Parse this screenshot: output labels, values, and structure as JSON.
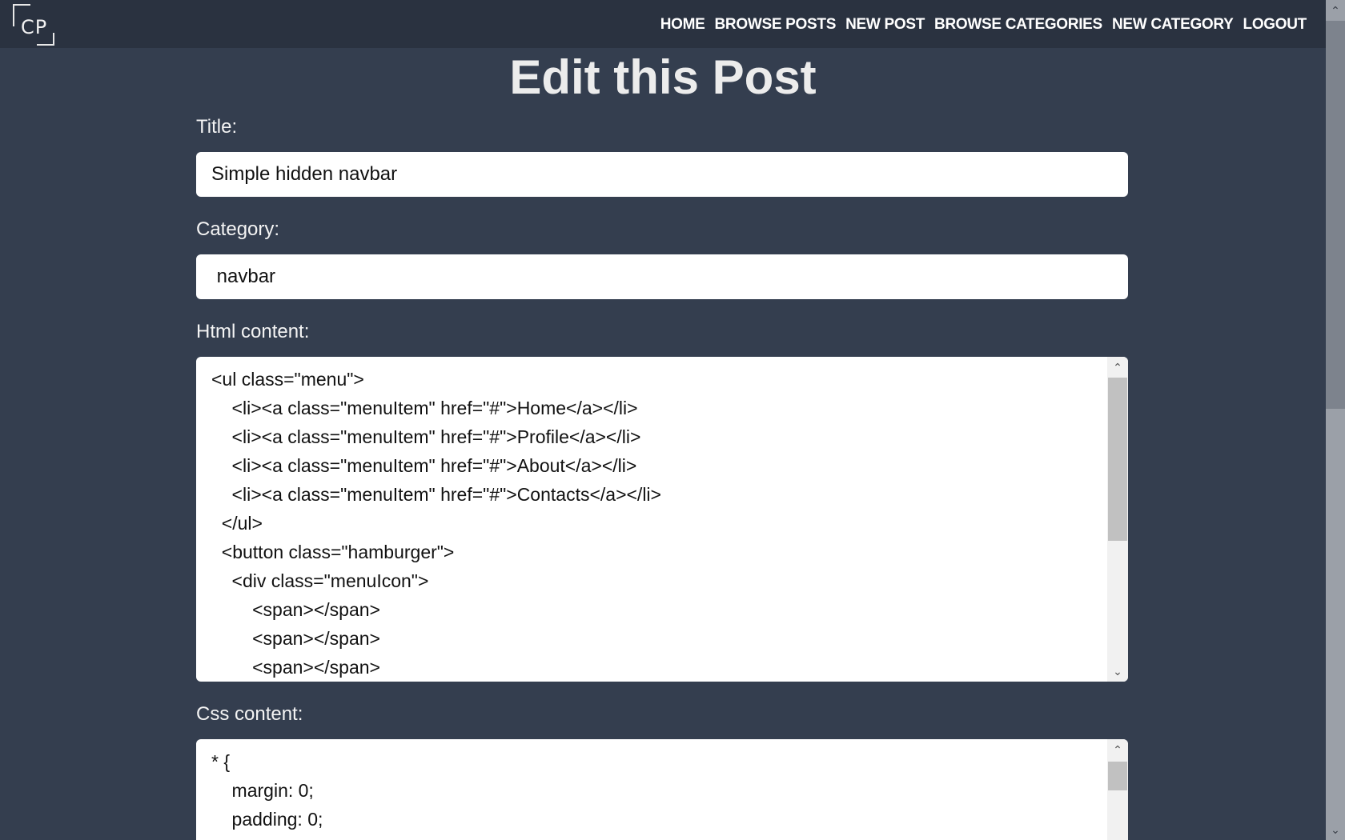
{
  "logo": {
    "text": "CP"
  },
  "nav": {
    "items": [
      "HOME",
      "BROWSE POSTS",
      "NEW POST",
      "BROWSE CATEGORIES",
      "NEW CATEGORY",
      "LOGOUT"
    ]
  },
  "page_title": "Edit this Post",
  "form": {
    "title_label": "Title:",
    "title_value": "Simple hidden navbar",
    "category_label": "Category:",
    "category_value": " navbar",
    "html_label": "Html content:",
    "html_value": "<ul class=\"menu\">\n    <li><a class=\"menuItem\" href=\"#\">Home</a></li>\n    <li><a class=\"menuItem\" href=\"#\">Profile</a></li>\n    <li><a class=\"menuItem\" href=\"#\">About</a></li>\n    <li><a class=\"menuItem\" href=\"#\">Contacts</a></li>\n  </ul>\n  <button class=\"hamburger\">\n    <div class=\"menuIcon\">\n        <span></span>\n        <span></span>\n        <span></span>",
    "css_label": "Css content:",
    "css_value": "* {\n    margin: 0;\n    padding: 0;"
  }
}
